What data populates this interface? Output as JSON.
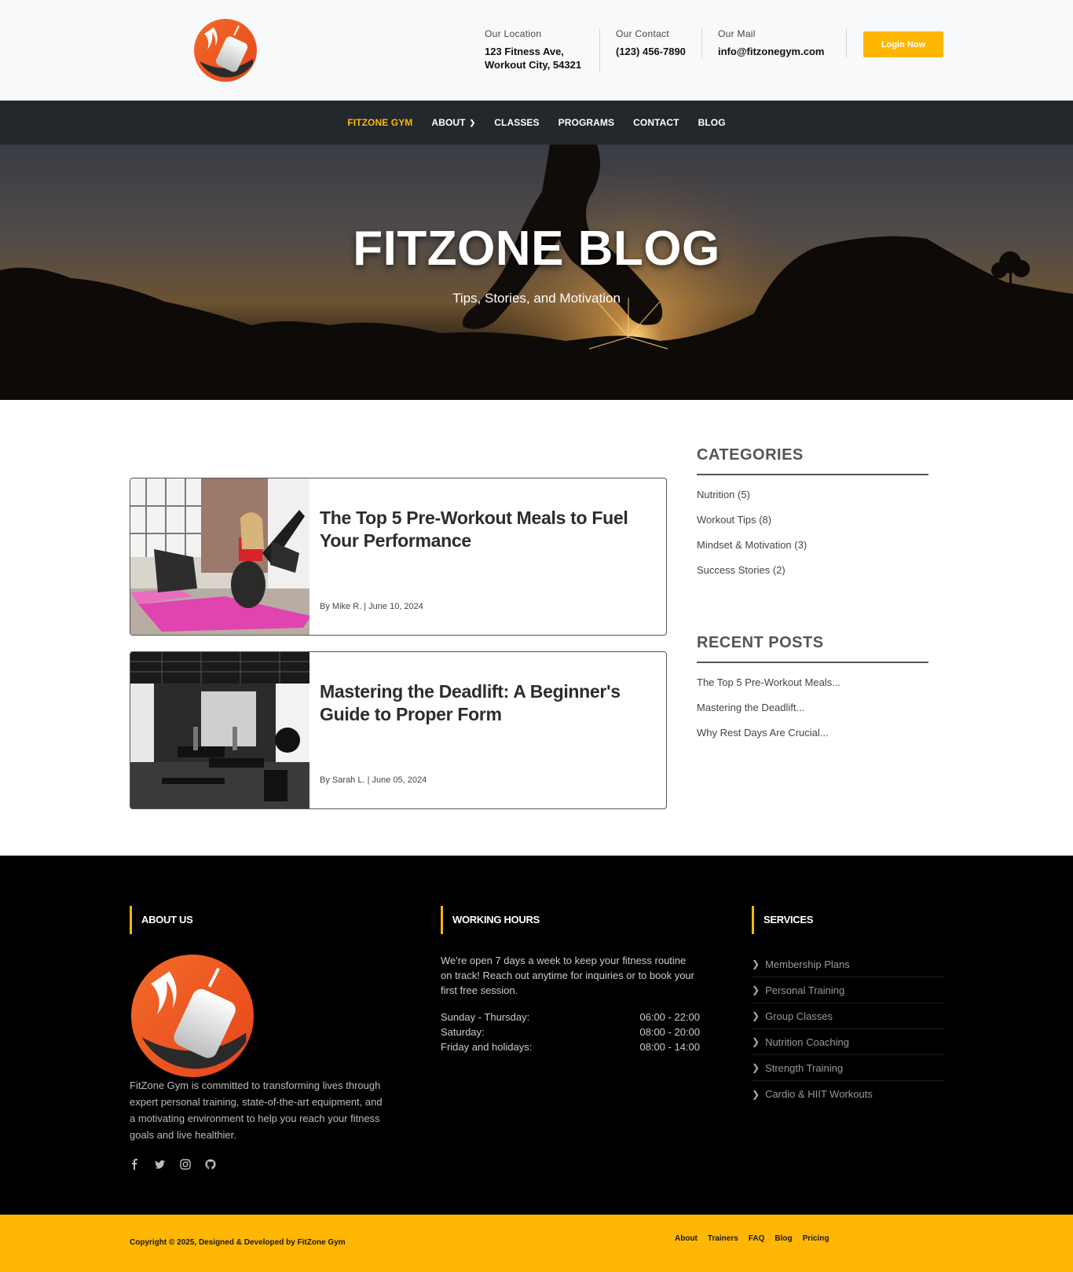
{
  "header": {
    "location_label": "Our Location",
    "location_line1": "123 Fitness Ave,",
    "location_line2": "Workout City, 54321",
    "contact_label": "Our Contact",
    "contact_value": "(123) 456-7890",
    "mail_label": "Our Mail",
    "mail_value": "info@fitzonegym.com",
    "login_label": "Login Now"
  },
  "nav": {
    "items": [
      {
        "label": "FITZONE GYM",
        "active": true
      },
      {
        "label": "ABOUT",
        "dropdown": true
      },
      {
        "label": "CLASSES"
      },
      {
        "label": "PROGRAMS"
      },
      {
        "label": "CONTACT"
      },
      {
        "label": "BLOG"
      }
    ]
  },
  "hero": {
    "title": "FITZONE BLOG",
    "subtitle": "Tips, Stories, and Motivation"
  },
  "posts": [
    {
      "title": "The Top 5 Pre-Workout Meals to Fuel Your Performance",
      "by": "By",
      "author": "Mike R.",
      "date": "June 10, 2024"
    },
    {
      "title": "Mastering the Deadlift: A Beginner's Guide to Proper Form",
      "by": "By",
      "author": "Sarah L.",
      "date": "June 05, 2024"
    }
  ],
  "sidebar": {
    "categories_title": "CATEGORIES",
    "categories": [
      "Nutrition (5)",
      "Workout Tips (8)",
      "Mindset & Motivation (3)",
      "Success Stories (2)"
    ],
    "recent_title": "RECENT POSTS",
    "recent": [
      "The Top 5 Pre-Workout Meals...",
      "Mastering the Deadlift...",
      "Why Rest Days Are Crucial..."
    ]
  },
  "footer": {
    "about_title": "ABOUT US",
    "about_text": "FitZone Gym is committed to transforming lives through expert personal training, state-of-the-art equipment, and a motivating environment to help you reach your fitness goals and live healthier.",
    "hours_title": "WORKING HOURS",
    "hours_text": "We're open 7 days a week to keep your fitness routine on track! Reach out anytime for inquiries or to book your first free session.",
    "hours": [
      {
        "day": "Sunday - Thursday:",
        "time": "06:00 - 22:00"
      },
      {
        "day": "Saturday:",
        "time": "08:00 - 20:00"
      },
      {
        "day": "Friday and holidays:",
        "time": "08:00 - 14:00"
      }
    ],
    "services_title": "SERVICES",
    "services": [
      "Membership Plans",
      "Personal Training",
      "Group Classes",
      "Nutrition Coaching",
      "Strength Training",
      "Cardio & HIIT Workouts"
    ],
    "social_icons": [
      "facebook-icon",
      "twitter-icon",
      "instagram-icon",
      "github-icon"
    ]
  },
  "bottombar": {
    "copyright": "Copyright © 2025, Designed & Developed by FitZone Gym",
    "links": [
      "About",
      "Trainers",
      "FAQ",
      "Blog",
      "Pricing"
    ]
  },
  "colors": {
    "accent": "#ffb703",
    "logo_orange": "#f0511d",
    "nav_bg": "#23282d",
    "footer_bg": "#000000"
  }
}
